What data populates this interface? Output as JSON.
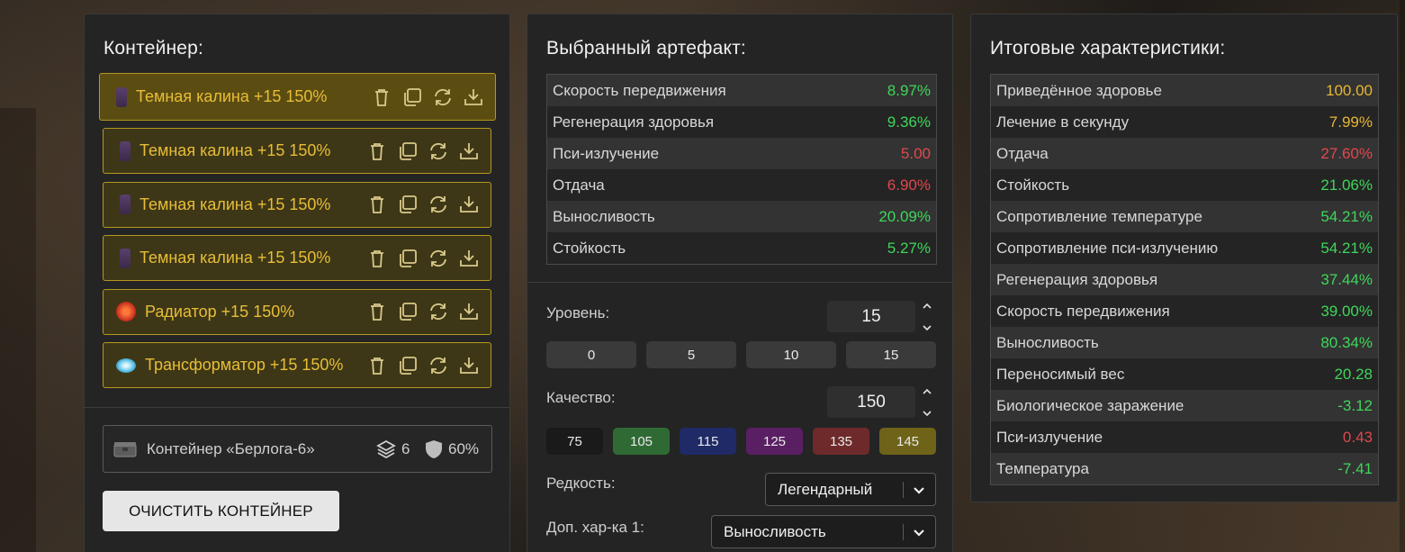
{
  "container_panel": {
    "title": "Контейнер:",
    "items": [
      {
        "name": "Темная калина +15 150%",
        "icon": "kalina-artifact-icon",
        "active": true
      },
      {
        "name": "Темная калина +15 150%",
        "icon": "kalina-artifact-icon",
        "active": false
      },
      {
        "name": "Темная калина +15 150%",
        "icon": "kalina-artifact-icon",
        "active": false
      },
      {
        "name": "Темная калина +15 150%",
        "icon": "kalina-artifact-icon",
        "active": false
      },
      {
        "name": "Радиатор +15 150%",
        "icon": "radiator-artifact-icon",
        "active": false
      },
      {
        "name": "Трансформатор +15 150%",
        "icon": "transformer-artifact-icon",
        "active": false
      }
    ],
    "item_actions": [
      "trash-icon",
      "copy-icon",
      "refresh-icon",
      "download-icon"
    ],
    "container": {
      "name": "Контейнер «Берлога-6»",
      "slots": "6",
      "protection": "60%"
    },
    "clear_button": "ОЧИСТИТЬ КОНТЕЙНЕР"
  },
  "selected_panel": {
    "title": "Выбранный артефакт:",
    "stats": [
      {
        "label": "Скорость передвижения",
        "value": "8.97%",
        "color": "green"
      },
      {
        "label": "Регенерация здоровья",
        "value": "9.36%",
        "color": "green"
      },
      {
        "label": "Пси-излучение",
        "value": "5.00",
        "color": "red"
      },
      {
        "label": "Отдача",
        "value": "6.90%",
        "color": "red"
      },
      {
        "label": "Выносливость",
        "value": "20.09%",
        "color": "green"
      },
      {
        "label": "Стойкость",
        "value": "5.27%",
        "color": "green"
      }
    ],
    "level": {
      "label": "Уровень:",
      "value": "15",
      "presets": [
        "0",
        "5",
        "10",
        "15"
      ]
    },
    "quality": {
      "label": "Качество:",
      "value": "150",
      "presets": [
        {
          "label": "75",
          "color": "#1a1a1a"
        },
        {
          "label": "105",
          "color": "#2f6a35"
        },
        {
          "label": "115",
          "color": "#1f2a66"
        },
        {
          "label": "125",
          "color": "#5a1f63"
        },
        {
          "label": "135",
          "color": "#6e2a2a"
        },
        {
          "label": "145",
          "color": "#6e6318"
        }
      ]
    },
    "rarity": {
      "label": "Редкость:",
      "value": "Легендарный"
    },
    "extra_stat": {
      "label": "Доп. хар-ка 1:",
      "value": "Выносливость"
    }
  },
  "total_panel": {
    "title": "Итоговые характеристики:",
    "stats": [
      {
        "label": "Приведённое здоровье",
        "value": "100.00",
        "color": "yellow"
      },
      {
        "label": "Лечение в секунду",
        "value": "7.99%",
        "color": "yellow"
      },
      {
        "label": "Отдача",
        "value": "27.60%",
        "color": "red"
      },
      {
        "label": "Стойкость",
        "value": "21.06%",
        "color": "green"
      },
      {
        "label": "Сопротивление температуре",
        "value": "54.21%",
        "color": "green"
      },
      {
        "label": "Сопротивление пси-излучению",
        "value": "54.21%",
        "color": "green"
      },
      {
        "label": "Регенерация здоровья",
        "value": "37.44%",
        "color": "green"
      },
      {
        "label": "Скорость передвижения",
        "value": "39.00%",
        "color": "green"
      },
      {
        "label": "Выносливость",
        "value": "80.34%",
        "color": "green"
      },
      {
        "label": "Переносимый вес",
        "value": "20.28",
        "color": "green"
      },
      {
        "label": "Биологическое заражение",
        "value": "-3.12",
        "color": "green"
      },
      {
        "label": "Пси-излучение",
        "value": "0.43",
        "color": "red"
      },
      {
        "label": "Температура",
        "value": "-7.41",
        "color": "green"
      }
    ]
  },
  "colors": {
    "accent_gold": "#e8bd36",
    "positive": "#3fd65b",
    "negative": "#e0484c",
    "neutral_yellow": "#e7b634"
  }
}
